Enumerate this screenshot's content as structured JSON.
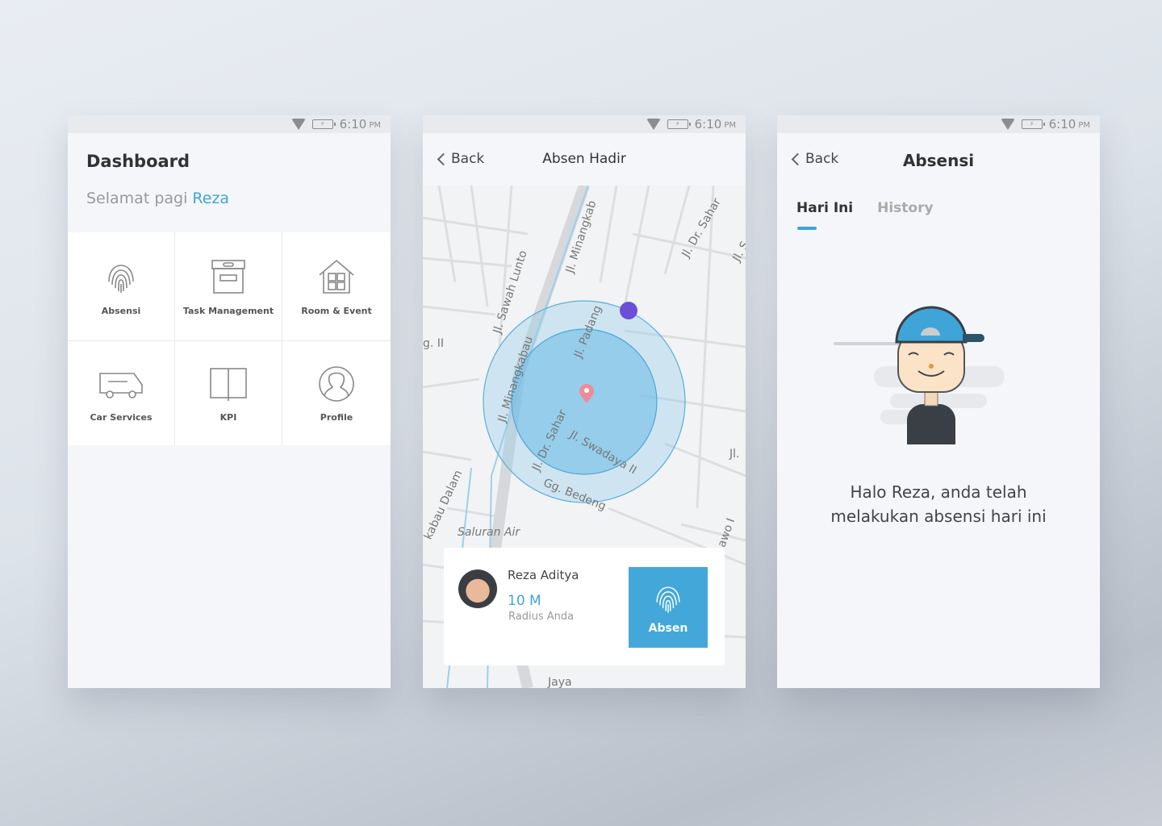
{
  "status_bar": {
    "time": "6:10",
    "ampm": "PM"
  },
  "dashboard": {
    "title": "Dashboard",
    "greeting": "Selamat pagi",
    "user": "Reza",
    "menu": [
      {
        "label": "Absensi",
        "icon": "fingerprint-icon"
      },
      {
        "label": "Task Management",
        "icon": "box-icon"
      },
      {
        "label": "Room & Event",
        "icon": "house-icon"
      },
      {
        "label": "Car Services",
        "icon": "van-icon"
      },
      {
        "label": "KPI",
        "icon": "book-icon"
      },
      {
        "label": "Profile",
        "icon": "profile-icon"
      }
    ]
  },
  "absen_hadir": {
    "back": "Back",
    "title": "Absen Hadir",
    "streets": [
      "Jl. Minangkab",
      "Jl. Dr. Sahar",
      "Jl. Sawah Lunto",
      "Jl. Padang",
      "Jl. Minangkabau",
      "Jl. Dr. Sahar",
      "Jl. Swadaya II",
      "Gg. Bedeng",
      "kabau Dalam",
      "Saluran Air",
      "g. II",
      "Jl.",
      "Jl.",
      "awo I",
      "Jl. S",
      "Jaya"
    ],
    "user_name": "Reza Aditya",
    "radius_value": "10 M",
    "radius_label": "Radius Anda",
    "absen_button": "Absen",
    "colors": {
      "radius": "#8ccbea",
      "user_dot": "#6b4fd6",
      "pin": "#ef8a9a"
    }
  },
  "absensi": {
    "back": "Back",
    "title": "Absensi",
    "tabs": [
      {
        "label": "Hari Ini",
        "active": true
      },
      {
        "label": "History",
        "active": false
      }
    ],
    "message_line1": "Halo Reza, anda telah",
    "message_line2": "melakukan absensi hari ini"
  },
  "colors": {
    "accent": "#3fa5d8"
  }
}
